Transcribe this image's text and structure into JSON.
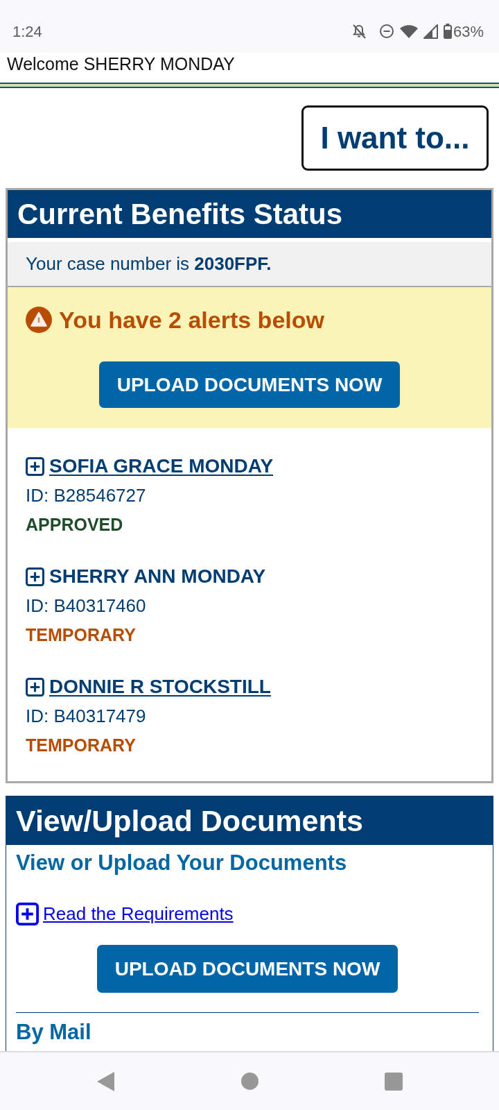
{
  "status_bar": {
    "time": "1:24",
    "battery": "63%"
  },
  "header": {
    "welcome": "Welcome SHERRY MONDAY"
  },
  "menu_button": {
    "label": "I want to..."
  },
  "benefits_panel": {
    "title": "Current Benefits Status",
    "case_number": "Your case number is **2030FPF.**",
    "alert": {
      "message": "You have 2 alerts below",
      "button": "UPLOAD DOCUMENTS NOW"
    },
    "members": [
      {
        "name": "SOFIA GRACE MONDAY",
        "linked": true,
        "id": "ID: B28546727",
        "status": "APPROVED",
        "color": "#1f4d2b"
      },
      {
        "name": "SHERRY ANN MONDAY",
        "linked": false,
        "id": "ID: B40317460",
        "status": "TEMPORARY",
        "color": "#b84c00"
      },
      {
        "name": "DONNIE R STOCKSTILL",
        "linked": true,
        "id": "ID: B40317479",
        "status": "TEMPORARY",
        "color": "#b84c00"
      }
    ]
  },
  "documents_panel": {
    "title": "View/Upload Documents",
    "subtitle": "View or Upload Your Documents",
    "requirements_link": "Read the Requirements",
    "button": "UPLOAD DOCUMENTS NOW",
    "next_heading": "By Mail"
  }
}
